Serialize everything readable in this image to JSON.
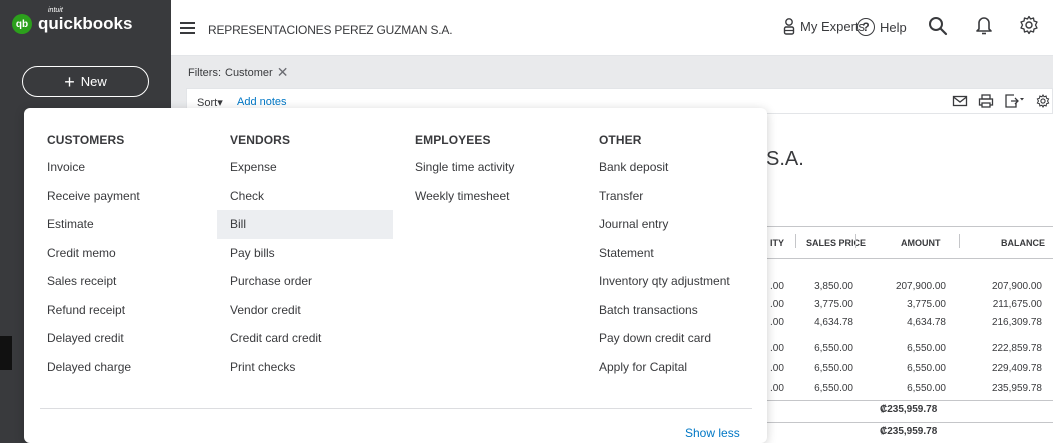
{
  "brand": {
    "intuit": "intuit",
    "name": "quickbooks",
    "mark": "qb"
  },
  "nav": {
    "new_label": "New"
  },
  "header": {
    "company": "REPRESENTACIONES PEREZ GUZMAN S.A.",
    "my_experts": "My Experts",
    "help": "Help"
  },
  "filters": {
    "label": "Filters:",
    "chip": "Customer"
  },
  "toolbar": {
    "sort": "Sort",
    "add_notes": "Add notes"
  },
  "report": {
    "company_tail": "S.A.",
    "columns": {
      "qty": "ITY",
      "sales_price": "SALES PRICE",
      "amount": "AMOUNT",
      "balance": "BALANCE"
    },
    "rows": [
      {
        "qty": ".00",
        "sales_price": "3,850.00",
        "amount": "207,900.00",
        "balance": "207,900.00"
      },
      {
        "qty": ".00",
        "sales_price": "3,775.00",
        "amount": "3,775.00",
        "balance": "211,675.00"
      },
      {
        "qty": ".00",
        "sales_price": "4,634.78",
        "amount": "4,634.78",
        "balance": "216,309.78"
      },
      {
        "qty": ".00",
        "sales_price": "6,550.00",
        "amount": "6,550.00",
        "balance": "222,859.78"
      },
      {
        "qty": ".00",
        "sales_price": "6,550.00",
        "amount": "6,550.00",
        "balance": "229,409.78"
      },
      {
        "qty": ".00",
        "sales_price": "6,550.00",
        "amount": "6,550.00",
        "balance": "235,959.78"
      }
    ],
    "total_1": "₡235,959.78",
    "total_2": "₡235,959.78"
  },
  "menu": {
    "customers": {
      "title": "CUSTOMERS",
      "items": [
        "Invoice",
        "Receive payment",
        "Estimate",
        "Credit memo",
        "Sales receipt",
        "Refund receipt",
        "Delayed credit",
        "Delayed charge"
      ]
    },
    "vendors": {
      "title": "VENDORS",
      "items": [
        "Expense",
        "Check",
        "Bill",
        "Pay bills",
        "Purchase order",
        "Vendor credit",
        "Credit card credit",
        "Print checks"
      ]
    },
    "employees": {
      "title": "EMPLOYEES",
      "items": [
        "Single time activity",
        "Weekly timesheet"
      ]
    },
    "other": {
      "title": "OTHER",
      "items": [
        "Bank deposit",
        "Transfer",
        "Journal entry",
        "Statement",
        "Inventory qty adjustment",
        "Batch transactions",
        "Pay down credit card",
        "Apply for Capital"
      ]
    },
    "highlighted": "Bill",
    "show_less": "Show less"
  },
  "colors": {
    "nav_bg": "#393a3d",
    "brand_green": "#2ca01c",
    "link_blue": "#0077c5",
    "highlight": "#eceef1"
  },
  "icons": [
    "hamburger-icon",
    "experts-icon",
    "help-icon",
    "search-icon",
    "bell-icon",
    "gear-icon",
    "close-icon",
    "mail-icon",
    "print-icon",
    "export-icon"
  ]
}
